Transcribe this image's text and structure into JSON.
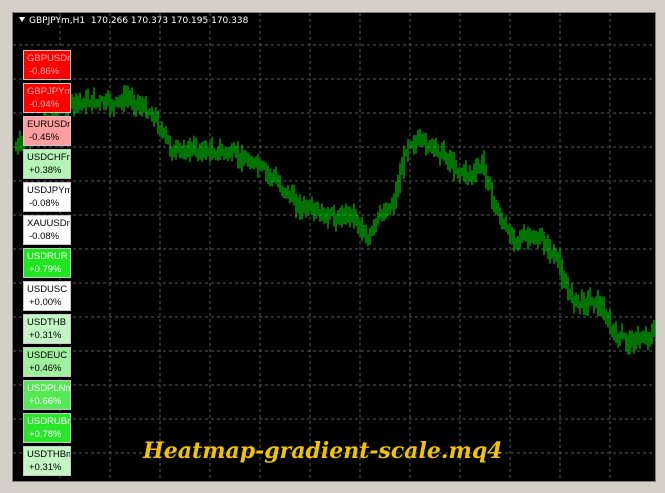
{
  "title": {
    "symbol": "GBPJPYm,H1",
    "open": "170.266",
    "high": "170.373",
    "low": "170.195",
    "close": "170.338"
  },
  "tiles": [
    {
      "symbol": "GBPUSDm",
      "change": "-0.86%",
      "bg": "#ff0000",
      "fg": "#ffb0b0"
    },
    {
      "symbol": "GBPJPYm",
      "change": "-0.94%",
      "bg": "#ff0000",
      "fg": "#ffb0b0"
    },
    {
      "symbol": "EURUSDm",
      "change": "-0.45%",
      "bg": "#ff9e9e",
      "fg": "#000000"
    },
    {
      "symbol": "USDCHFm",
      "change": "+0.38%",
      "bg": "#b6f5b6",
      "fg": "#000000"
    },
    {
      "symbol": "USDJPYm",
      "change": "-0.08%",
      "bg": "#ffffff",
      "fg": "#000000"
    },
    {
      "symbol": "XAUUSDm",
      "change": "-0.08%",
      "bg": "#ffffff",
      "fg": "#000000"
    },
    {
      "symbol": "USDRUR",
      "change": "+0.79%",
      "bg": "#1ee61e",
      "fg": "#ffffff"
    },
    {
      "symbol": "USDUSC",
      "change": "+0.00%",
      "bg": "#ffffff",
      "fg": "#000000"
    },
    {
      "symbol": "USDTHB",
      "change": "+0.31%",
      "bg": "#c4f5c4",
      "fg": "#000000"
    },
    {
      "symbol": "USDEUC",
      "change": "+0.46%",
      "bg": "#a0f0a0",
      "fg": "#000000"
    },
    {
      "symbol": "USDPLNm",
      "change": "+0.66%",
      "bg": "#55e955",
      "fg": "#ffffff"
    },
    {
      "symbol": "USDRUBm",
      "change": "+0.78%",
      "bg": "#2ae62a",
      "fg": "#ffffff"
    },
    {
      "symbol": "USDTHBm",
      "change": "+0.31%",
      "bg": "#c4f5c4",
      "fg": "#000000"
    }
  ],
  "watermark": "Heatmap-gradient-scale.mq4",
  "colors": {
    "background": "#000000",
    "grid": "#5a5a5a",
    "bars": "#00e600",
    "watermark": "#f2c300"
  }
}
